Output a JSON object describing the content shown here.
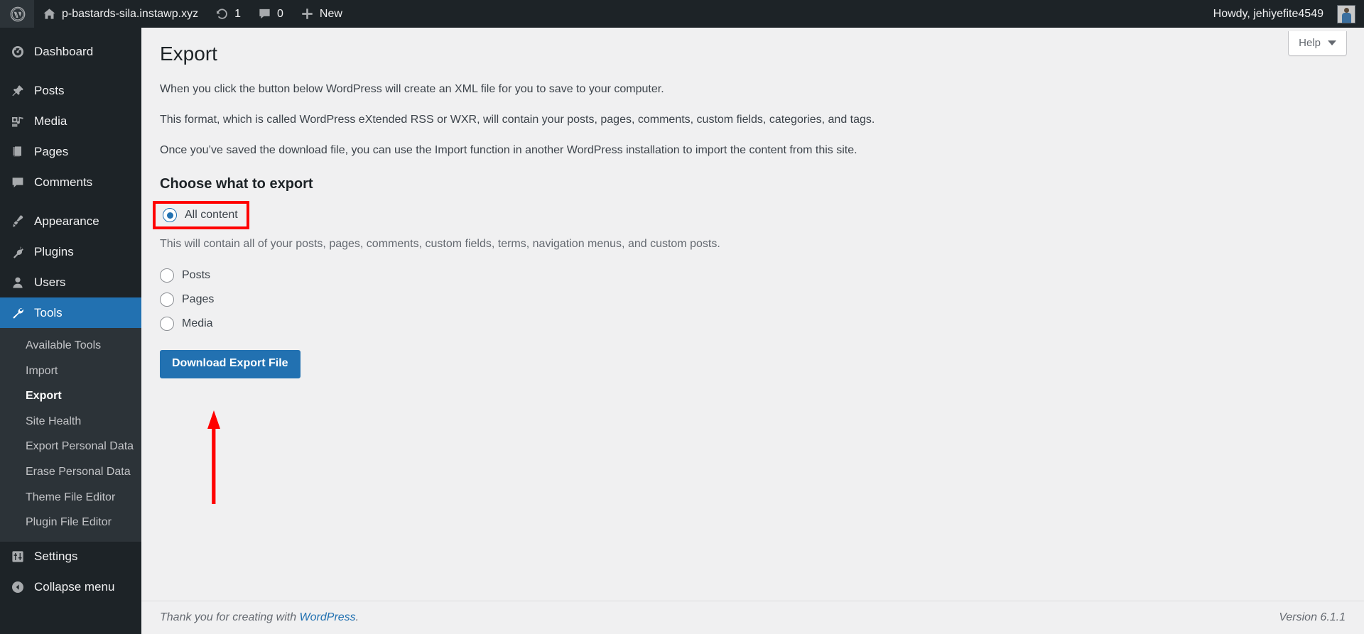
{
  "adminbar": {
    "wp_logo_icon": "wordpress-logo-icon",
    "site_home_icon": "home-icon",
    "site_name": "p-bastards-sila.instawp.xyz",
    "updates_icon": "updates-sync-icon",
    "updates_count": "1",
    "comments_icon": "comment-bubble-icon",
    "comments_count": "0",
    "new_icon": "plus-icon",
    "new_label": "New",
    "howdy": "Howdy, jehiyefite4549",
    "avatar_icon": "user-avatar"
  },
  "sidebar": {
    "items": [
      {
        "label": "Dashboard",
        "icon": "dashboard-gauge-icon",
        "current": false
      },
      {
        "label": "Posts",
        "icon": "pin-icon",
        "current": false
      },
      {
        "label": "Media",
        "icon": "media-camera-music-icon",
        "current": false
      },
      {
        "label": "Pages",
        "icon": "pages-document-icon",
        "current": false
      },
      {
        "label": "Comments",
        "icon": "comment-bubble-icon",
        "current": false
      },
      {
        "label": "Appearance",
        "icon": "paintbrush-icon",
        "current": false
      },
      {
        "label": "Plugins",
        "icon": "plug-icon",
        "current": false
      },
      {
        "label": "Users",
        "icon": "user-icon",
        "current": false
      },
      {
        "label": "Tools",
        "icon": "wrench-icon",
        "current": true
      },
      {
        "label": "Settings",
        "icon": "settings-sliders-icon",
        "current": false
      }
    ],
    "submenu": [
      {
        "label": "Available Tools",
        "current": false
      },
      {
        "label": "Import",
        "current": false
      },
      {
        "label": "Export",
        "current": true
      },
      {
        "label": "Site Health",
        "current": false
      },
      {
        "label": "Export Personal Data",
        "current": false
      },
      {
        "label": "Erase Personal Data",
        "current": false
      },
      {
        "label": "Theme File Editor",
        "current": false
      },
      {
        "label": "Plugin File Editor",
        "current": false
      }
    ],
    "collapse_label": "Collapse menu",
    "collapse_icon": "chevron-left-circle-icon"
  },
  "help": {
    "label": "Help",
    "caret_icon": "chevron-down-icon"
  },
  "main": {
    "page_title": "Export",
    "paragraph_1": "When you click the button below WordPress will create an XML file for you to save to your computer.",
    "paragraph_2": "This format, which is called WordPress eXtended RSS or WXR, will contain your posts, pages, comments, custom fields, categories, and tags.",
    "paragraph_3": "Once you’ve saved the download file, you can use the Import function in another WordPress installation to import the content from this site.",
    "section_title": "Choose what to export",
    "options": [
      {
        "label": "All content",
        "checked": true
      },
      {
        "label": "Posts",
        "checked": false
      },
      {
        "label": "Pages",
        "checked": false
      },
      {
        "label": "Media",
        "checked": false
      }
    ],
    "all_content_description": "This will contain all of your posts, pages, comments, custom fields, terms, navigation menus, and custom posts.",
    "submit_label": "Download Export File"
  },
  "annotations": {
    "highlight_color": "#ff0000",
    "arrow_color": "#ff0000",
    "arrow_direction": "up",
    "arrow_target": "Download Export File"
  },
  "footer": {
    "thanks_prefix": "Thank you for creating with ",
    "wordpress_link": "WordPress",
    "thanks_suffix": ".",
    "version": "Version 6.1.1"
  },
  "colors": {
    "admin_blue": "#2271b1",
    "sidebar_bg": "#1d2327",
    "submenu_bg": "#2c3338",
    "content_bg": "#f0f0f1",
    "annotation_red": "#ff0000"
  }
}
